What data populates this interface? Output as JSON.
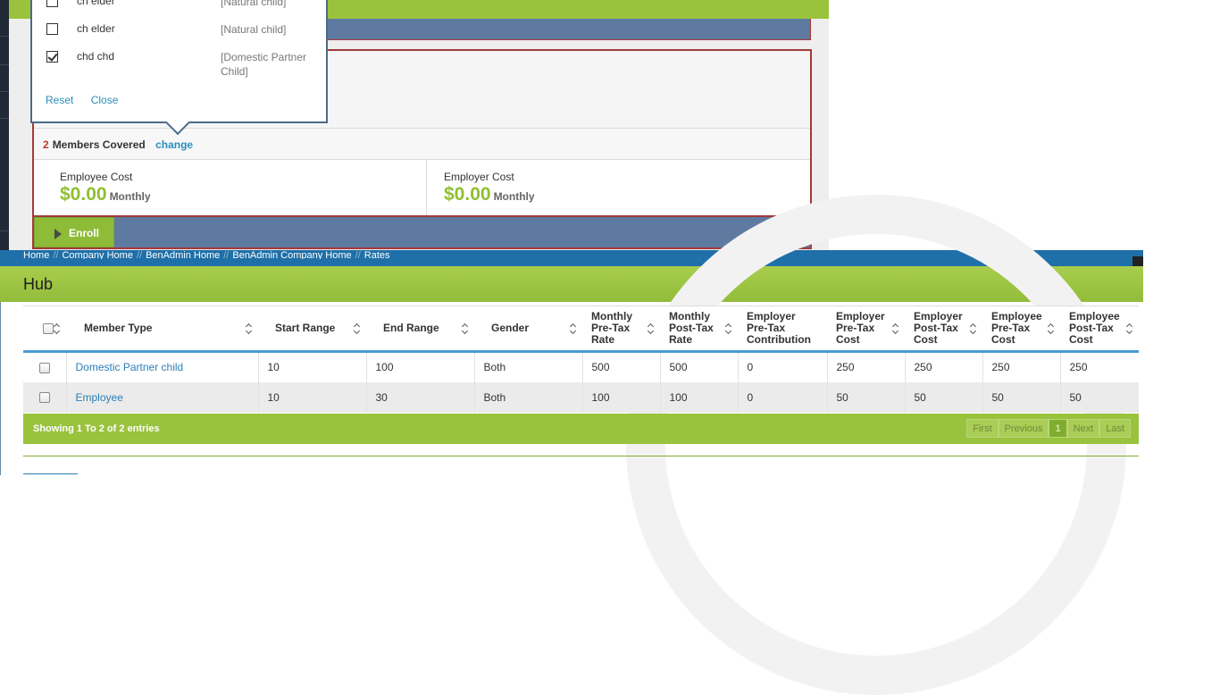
{
  "popover": {
    "members": [
      {
        "name": "ch elder",
        "relation": "[Natural child]",
        "checked": false
      },
      {
        "name": "ch elder",
        "relation": "[Natural child]",
        "checked": false
      },
      {
        "name": "chd chd",
        "relation": "[Domestic Partner Child]",
        "checked": true
      }
    ],
    "reset_label": "Reset",
    "close_label": "Close"
  },
  "plan": {
    "members_count": "2",
    "members_label": "Members Covered",
    "change_label": "change",
    "employee_cost_label": "Employee Cost",
    "employee_cost_value": "$0.00",
    "employee_cost_unit": "Monthly",
    "employer_cost_label": "Employer Cost",
    "employer_cost_value": "$0.00",
    "employer_cost_unit": "Monthly",
    "enroll_label": "Enroll"
  },
  "breadcrumb": [
    "Home",
    "Company Home",
    "BenAdmin Home",
    "BenAdmin Company Home",
    "Rates"
  ],
  "hub": {
    "title": "Hub"
  },
  "table": {
    "columns": [
      {
        "label": "",
        "sortable": true
      },
      {
        "label": "Member Type",
        "sortable": true
      },
      {
        "label": "Start Range",
        "sortable": true
      },
      {
        "label": "End Range",
        "sortable": true
      },
      {
        "label": "Gender",
        "sortable": true
      },
      {
        "label": "Monthly Pre-Tax Rate",
        "sortable": true
      },
      {
        "label": "Monthly Post-Tax Rate",
        "sortable": true
      },
      {
        "label": "Employer Pre-Tax Contribution",
        "sortable": false
      },
      {
        "label": "Employer Pre-Tax Cost",
        "sortable": true
      },
      {
        "label": "Employer Post-Tax Cost",
        "sortable": true
      },
      {
        "label": "Employee Pre-Tax Cost",
        "sortable": true
      },
      {
        "label": "Employee Post-Tax Cost",
        "sortable": true
      }
    ],
    "rows": [
      {
        "member_type": "Domestic Partner child",
        "start_range": "10",
        "end_range": "100",
        "gender": "Both",
        "monthly_pre_tax_rate": "500",
        "monthly_post_tax_rate": "500",
        "employer_pre_tax_contribution": "0",
        "employer_pre_tax_cost": "250",
        "employer_post_tax_cost": "250",
        "employee_pre_tax_cost": "250",
        "employee_post_tax_cost": "250"
      },
      {
        "member_type": "Employee",
        "start_range": "10",
        "end_range": "30",
        "gender": "Both",
        "monthly_pre_tax_rate": "100",
        "monthly_post_tax_rate": "100",
        "employer_pre_tax_contribution": "0",
        "employer_pre_tax_cost": "50",
        "employer_post_tax_cost": "50",
        "employee_pre_tax_cost": "50",
        "employee_post_tax_cost": "50"
      }
    ],
    "showing_text": "Showing 1 To 2 of 2 entries",
    "pager": {
      "first": "First",
      "previous": "Previous",
      "current": "1",
      "next": "Next",
      "last": "Last"
    }
  },
  "colors": {
    "accent_green": "#9bc23d",
    "header_blue": "#5e7aa0",
    "link_blue": "#2a8fbd",
    "card_border": "#a33a3a"
  }
}
